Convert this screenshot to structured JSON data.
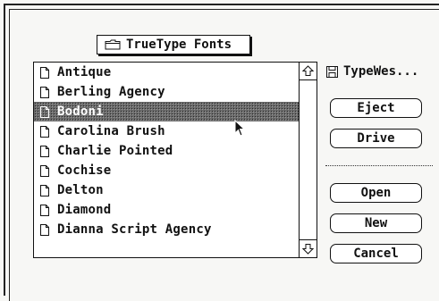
{
  "folder_popup": {
    "label": "TrueType Fonts",
    "icon": "folder-icon"
  },
  "file_list": {
    "items": [
      "Antique",
      "Berling Agency",
      "Bodoni",
      "Carolina Brush",
      "Charlie Pointed",
      "Cochise",
      "Delton",
      "Diamond",
      "Dianna Script Agency"
    ],
    "selected": "Bodoni"
  },
  "disk": {
    "name": "TypeWes...",
    "icon": "floppy-disk-icon"
  },
  "buttons": {
    "eject": "Eject",
    "drive": "Drive",
    "open": "Open",
    "new": "New",
    "cancel": "Cancel"
  }
}
